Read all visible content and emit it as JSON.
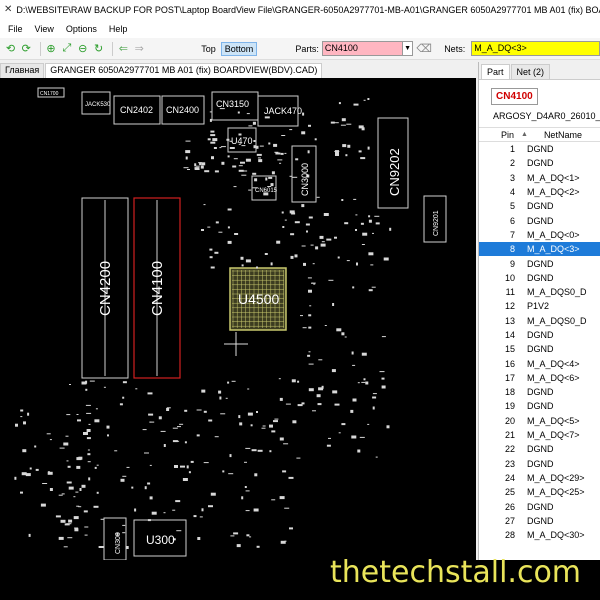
{
  "window": {
    "title": "D:\\WEBSITE\\RAW BACKUP FOR POST\\Laptop BoardView File\\GRANGER-6050A2977701-MB-A01\\GRANGER 6050A2977701 MB A01 (fix) BOARDVIEW"
  },
  "menu": [
    "File",
    "View",
    "Options",
    "Help"
  ],
  "toolbar": {
    "top_label": "Top",
    "bottom_label": "Bottom",
    "parts_label": "Parts:",
    "parts_value": "CN4100",
    "nets_label": "Nets:",
    "nets_value": "M_A_DQ<3>"
  },
  "doc_tabs": [
    "Главная",
    "GRANGER 6050A2977701 MB A01 (fix) BOARDVIEW(BDV).CAD)"
  ],
  "board": {
    "labels": {
      "cn1700": "CN1700",
      "jack530": "JACK530",
      "cn2402": "CN2402",
      "cn2400": "CN2400",
      "cn3150": "CN3150",
      "jack470": "JACK470",
      "u470": "U470",
      "cn9202": "CN9202",
      "cn3000": "CN3000",
      "cn6015": "CN6015",
      "cn9201": "CN9201",
      "cn4200": "CN4200",
      "cn4100": "CN4100",
      "u4500": "U4500",
      "u300": "U300",
      "cn300": "CN300"
    }
  },
  "panel": {
    "tabs": [
      "Part",
      "Net (2)"
    ],
    "part_name": "CN4100",
    "part_desc": "ARGOSY_D4AR0_26010_",
    "col_pin": "Pin",
    "col_net": "NetName",
    "rows": [
      {
        "pin": "1",
        "net": "DGND"
      },
      {
        "pin": "2",
        "net": "DGND"
      },
      {
        "pin": "3",
        "net": "M_A_DQ<1>"
      },
      {
        "pin": "4",
        "net": "M_A_DQ<2>"
      },
      {
        "pin": "5",
        "net": "DGND"
      },
      {
        "pin": "6",
        "net": "DGND"
      },
      {
        "pin": "7",
        "net": "M_A_DQ<0>"
      },
      {
        "pin": "8",
        "net": "M_A_DQ<3>"
      },
      {
        "pin": "9",
        "net": "DGND"
      },
      {
        "pin": "10",
        "net": "DGND"
      },
      {
        "pin": "11",
        "net": "M_A_DQS0_D"
      },
      {
        "pin": "12",
        "net": "P1V2"
      },
      {
        "pin": "13",
        "net": "M_A_DQS0_D"
      },
      {
        "pin": "14",
        "net": "DGND"
      },
      {
        "pin": "15",
        "net": "DGND"
      },
      {
        "pin": "16",
        "net": "M_A_DQ<4>"
      },
      {
        "pin": "17",
        "net": "M_A_DQ<6>"
      },
      {
        "pin": "18",
        "net": "DGND"
      },
      {
        "pin": "19",
        "net": "DGND"
      },
      {
        "pin": "20",
        "net": "M_A_DQ<5>"
      },
      {
        "pin": "21",
        "net": "M_A_DQ<7>"
      },
      {
        "pin": "22",
        "net": "DGND"
      },
      {
        "pin": "23",
        "net": "DGND"
      },
      {
        "pin": "24",
        "net": "M_A_DQ<29>"
      },
      {
        "pin": "25",
        "net": "M_A_DQ<25>"
      },
      {
        "pin": "26",
        "net": "DGND"
      },
      {
        "pin": "27",
        "net": "DGND"
      },
      {
        "pin": "28",
        "net": "M_A_DQ<30>"
      }
    ],
    "selected_pin": "8"
  },
  "watermark": "thetechstall.com",
  "colors": {
    "parts_bg": "#ffb6c1",
    "nets_bg": "#ffff00",
    "selected_row": "#1e7bd9",
    "part_name": "#d00000",
    "highlight_outline": "#d02020",
    "u4500": "#c8c86e",
    "watermark": "#e9e45a"
  }
}
